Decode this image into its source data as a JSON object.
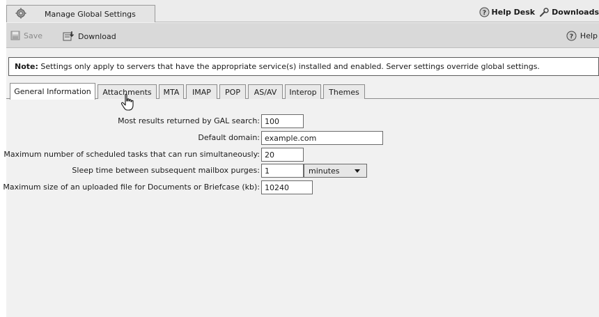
{
  "app_tab": {
    "title": "Manage Global Settings"
  },
  "top_links": {
    "help_desk": "Help Desk",
    "downloads": "Downloads"
  },
  "toolbar": {
    "save": "Save",
    "download": "Download",
    "help": "Help"
  },
  "note": {
    "prefix": "Note:",
    "text": " Settings only apply to servers that have the appropriate service(s) installed and enabled. Server settings override global settings."
  },
  "tabs": [
    {
      "label": "General Information",
      "active": true
    },
    {
      "label": "Attachments",
      "active": false
    },
    {
      "label": "MTA",
      "active": false
    },
    {
      "label": "IMAP",
      "active": false
    },
    {
      "label": "POP",
      "active": false
    },
    {
      "label": "AS/AV",
      "active": false
    },
    {
      "label": "Interop",
      "active": false
    },
    {
      "label": "Themes",
      "active": false
    }
  ],
  "form": {
    "gal_results": {
      "label": "Most results returned by GAL search:",
      "value": "100"
    },
    "default_domain": {
      "label": "Default domain:",
      "value": "example.com"
    },
    "max_tasks": {
      "label": "Maximum number of scheduled tasks that can run simultaneously:",
      "value": "20"
    },
    "sleep_time": {
      "label": "Sleep time between subsequent mailbox purges:",
      "value": "1",
      "unit": "minutes"
    },
    "max_upload": {
      "label": "Maximum size of an uploaded file for Documents or Briefcase (kb):",
      "value": "10240"
    }
  }
}
